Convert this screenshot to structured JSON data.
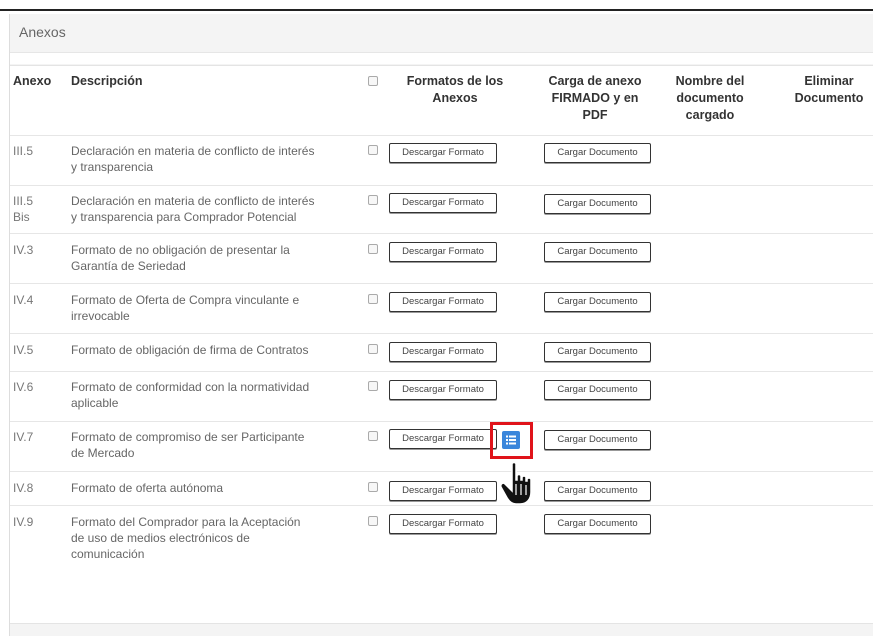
{
  "panel": {
    "title": "Anexos"
  },
  "table": {
    "headers": {
      "anexo": "Anexo",
      "descripcion": "Descripción",
      "formatos": [
        "Formatos de los",
        "Anexos"
      ],
      "carga": [
        "Carga de anexo",
        "FIRMADO y en",
        "PDF"
      ],
      "nombre": [
        "Nombre del",
        "documento",
        "cargado"
      ],
      "eliminar": [
        "Eliminar",
        "Documento"
      ]
    },
    "download_label": "Descargar Formato",
    "upload_label": "Cargar Documento",
    "rows": [
      {
        "anexo": [
          "III.5"
        ],
        "desc": [
          "Declaración en materia de conflicto de interés",
          "y transparencia"
        ]
      },
      {
        "anexo": [
          "III.5",
          "Bis"
        ],
        "desc": [
          "Declaración en materia de conflicto de interés",
          "y transparencia para Comprador Potencial"
        ]
      },
      {
        "anexo": [
          "IV.3"
        ],
        "desc": [
          "Formato de no obligación de presentar la",
          "Garantía de Seriedad"
        ]
      },
      {
        "anexo": [
          "IV.4"
        ],
        "desc": [
          "Formato de Oferta de Compra vinculante e",
          "irrevocable"
        ]
      },
      {
        "anexo": [
          "IV.5"
        ],
        "desc": [
          "Formato de obligación de firma de Contratos"
        ]
      },
      {
        "anexo": [
          "IV.6"
        ],
        "desc": [
          "Formato de conformidad con la normatividad",
          "aplicable"
        ]
      },
      {
        "anexo": [
          "IV.7"
        ],
        "desc": [
          "Formato de compromiso de ser Participante",
          "de Mercado"
        ]
      },
      {
        "anexo": [
          "IV.8"
        ],
        "desc": [
          "Formato de oferta autónoma"
        ]
      },
      {
        "anexo": [
          "IV.9"
        ],
        "desc": [
          "Formato del Comprador para la Aceptación",
          "de uso de medios electrónicos de",
          "comunicación"
        ]
      }
    ]
  },
  "colors": {
    "highlight": "#e0131a",
    "list_button": "#3b86db"
  },
  "icons": {
    "list": "list-icon",
    "cursor": "hand-pointer-icon"
  }
}
